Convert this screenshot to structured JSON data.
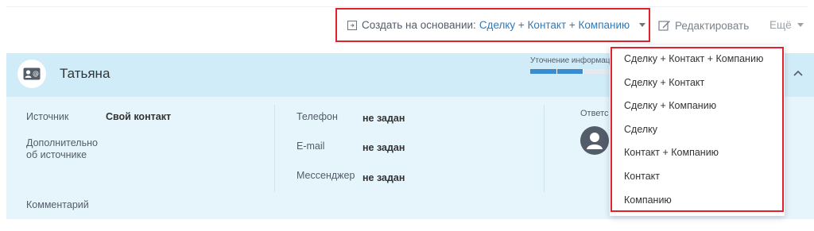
{
  "toolbar": {
    "create_label": "Создать на основании:",
    "create_selected": "Сделку + Контакт + Компанию",
    "edit_label": "Редактировать",
    "more_label": "Ещё"
  },
  "card": {
    "name": "Татьяна",
    "progress_label": "Уточнение информации",
    "progress_fill": 0.66,
    "fields_left": [
      {
        "label": "Источник",
        "value": "Свой контакт"
      },
      {
        "label": "Дополнительно об источнике",
        "value": ""
      }
    ],
    "comment_label": "Комментарий",
    "fields_middle": [
      {
        "label": "Телефон",
        "value": "не задан"
      },
      {
        "label": "E-mail",
        "value": "не задан"
      },
      {
        "label": "Мессенджер",
        "value": "не задан"
      }
    ],
    "responsible_label": "Ответс"
  },
  "dropdown": {
    "items": [
      "Сделку + Контакт + Компанию",
      "Сделку + Контакт",
      "Сделку + Компанию",
      "Сделку",
      "Контакт + Компанию",
      "Контакт",
      "Компанию"
    ]
  },
  "colors": {
    "highlight": "#e0222f",
    "link": "#2f7ab8",
    "header_bg": "#d1ecf9",
    "body_bg": "#e6f4fc",
    "progress": "#3a8ccf"
  }
}
